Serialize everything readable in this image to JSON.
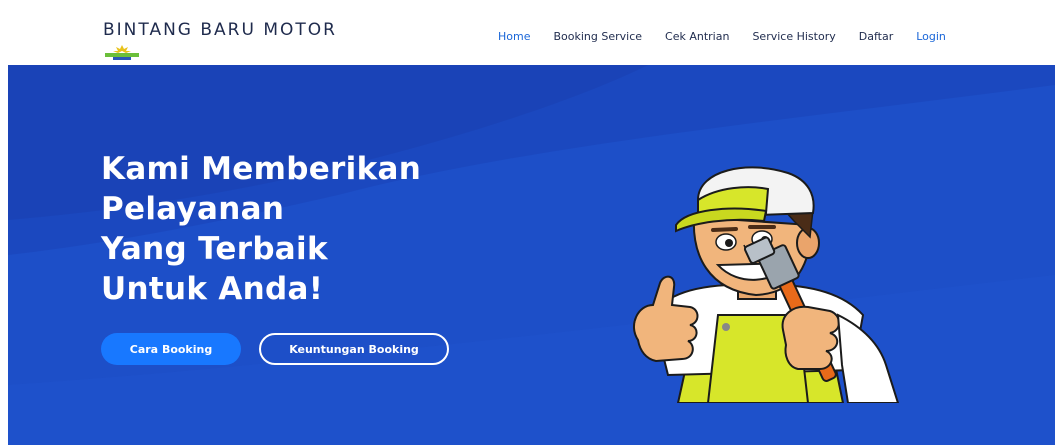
{
  "header": {
    "brand": "BINTANG BARU MOTOR",
    "logo_name": "bintang-baru-motor-logo",
    "nav": [
      {
        "label": "Home",
        "active": true
      },
      {
        "label": "Booking Service",
        "active": false
      },
      {
        "label": "Cek Antrian",
        "active": false
      },
      {
        "label": "Service History",
        "active": false
      },
      {
        "label": "Daftar",
        "active": false
      },
      {
        "label": "Login",
        "active": false
      }
    ]
  },
  "hero": {
    "headline": [
      "Kami Memberikan",
      "Pelayanan",
      "Yang Terbaik",
      "Untuk Anda!"
    ],
    "primary_button": "Cara Booking",
    "secondary_button": "Keuntungan Booking",
    "illustration": "mechanic-with-wrench-illustration"
  },
  "colors": {
    "hero_bg": "#1d4fc8",
    "primary_button": "#1878ff",
    "nav_active": "#1a66d8",
    "brand_text": "#1f2b4d"
  }
}
